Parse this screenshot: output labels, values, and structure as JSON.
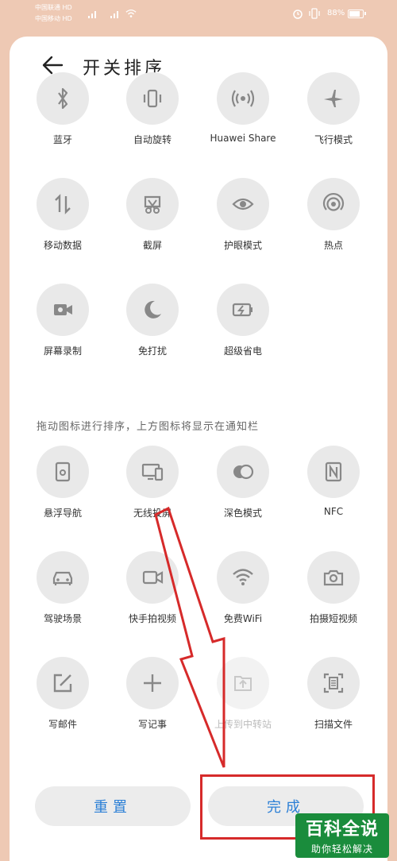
{
  "status_bar": {
    "carrier_1": "中国联通 HD",
    "carrier_2": "中国移动 HD",
    "battery_text": "88%",
    "battery_level": 0.88
  },
  "header": {
    "title": "开关排序"
  },
  "top_section": {
    "items": [
      {
        "label": "蓝牙",
        "icon": "bluetooth-icon"
      },
      {
        "label": "自动旋转",
        "icon": "auto-rotate-icon"
      },
      {
        "label": "Huawei Share",
        "icon": "huawei-share-icon"
      },
      {
        "label": "飞行模式",
        "icon": "airplane-icon"
      },
      {
        "label": "移动数据",
        "icon": "mobile-data-icon"
      },
      {
        "label": "截屏",
        "icon": "screenshot-icon"
      },
      {
        "label": "护眼模式",
        "icon": "eye-icon"
      },
      {
        "label": "热点",
        "icon": "hotspot-icon"
      },
      {
        "label": "屏幕录制",
        "icon": "screen-record-icon"
      },
      {
        "label": "免打扰",
        "icon": "moon-icon"
      },
      {
        "label": "超级省电",
        "icon": "battery-saver-icon"
      }
    ]
  },
  "hint_text": "拖动图标进行排序，上方图标将显示在通知栏",
  "bottom_section": {
    "items": [
      {
        "label": "悬浮导航",
        "icon": "floating-nav-icon"
      },
      {
        "label": "无线投屏",
        "icon": "wireless-projection-icon"
      },
      {
        "label": "深色模式",
        "icon": "dark-mode-icon"
      },
      {
        "label": "NFC",
        "icon": "nfc-icon"
      },
      {
        "label": "驾驶场景",
        "icon": "car-icon"
      },
      {
        "label": "快手拍视频",
        "icon": "video-camera-icon"
      },
      {
        "label": "免费WiFi",
        "icon": "wifi-icon"
      },
      {
        "label": "拍摄短视频",
        "icon": "camera-icon"
      },
      {
        "label": "写邮件",
        "icon": "edit-mail-icon"
      },
      {
        "label": "写记事",
        "icon": "plus-icon"
      },
      {
        "label": "上传到中转站",
        "icon": "upload-folder-icon"
      },
      {
        "label": "扫描文件",
        "icon": "scan-document-icon"
      }
    ]
  },
  "buttons": {
    "reset": "重置",
    "done": "完成"
  },
  "watermark": {
    "line1": "百科全说",
    "line2": "助你轻松解决"
  }
}
